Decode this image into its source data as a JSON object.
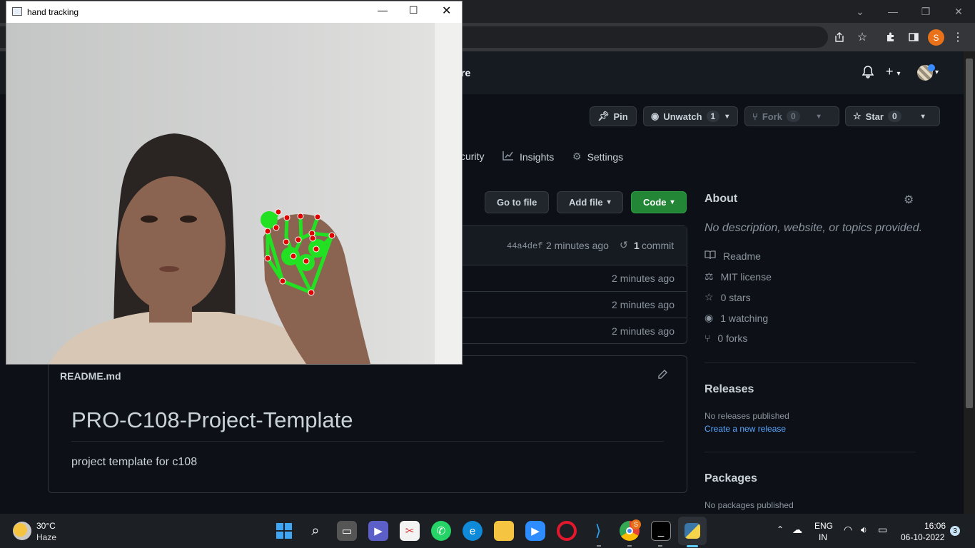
{
  "browser": {
    "window_controls": [
      "⌄",
      "—",
      "❐",
      "✕"
    ],
    "profile_initial": "S"
  },
  "github": {
    "header_partial_text": "re",
    "repo_actions": {
      "pin": "Pin",
      "unwatch": "Unwatch",
      "unwatch_count": "1",
      "fork": "Fork",
      "fork_count": "0",
      "star": "Star",
      "star_count": "0"
    },
    "tabs": [
      {
        "label": "curity"
      },
      {
        "label": "Insights"
      },
      {
        "label": "Settings"
      }
    ],
    "file_buttons": {
      "go_to_file": "Go to file",
      "add_file": "Add file",
      "code": "Code"
    },
    "latest_commit": {
      "hash": "44a4def",
      "time": "2 minutes ago",
      "commits": "1",
      "commits_label": "commit"
    },
    "file_rows": [
      {
        "time": "2 minutes ago"
      },
      {
        "time": "2 minutes ago"
      },
      {
        "time": "2 minutes ago"
      }
    ],
    "readme": {
      "filename": "README.md",
      "heading": "PRO-C108-Project-Template",
      "body": "project template for c108"
    },
    "about": {
      "title": "About",
      "description": "No description, website, or topics provided.",
      "items": [
        {
          "icon": "book-icon",
          "label": "Readme"
        },
        {
          "icon": "scale-icon",
          "label": "MIT license"
        },
        {
          "icon": "star-icon",
          "label": "0 stars"
        },
        {
          "icon": "eye-icon",
          "label": "1 watching"
        },
        {
          "icon": "fork-icon",
          "label": "0 forks"
        }
      ]
    },
    "releases": {
      "title": "Releases",
      "none_text": "No releases published",
      "create_link": "Create a new release"
    },
    "packages": {
      "title": "Packages",
      "none_text": "No packages published"
    }
  },
  "camera_window": {
    "title": "hand tracking"
  },
  "taskbar": {
    "weather_temp": "30°C",
    "weather_desc": "Haze",
    "language": "ENG",
    "region": "IN",
    "time": "16:06",
    "date": "06-10-2022",
    "notification_count": "3",
    "chrome_badge": "S"
  }
}
